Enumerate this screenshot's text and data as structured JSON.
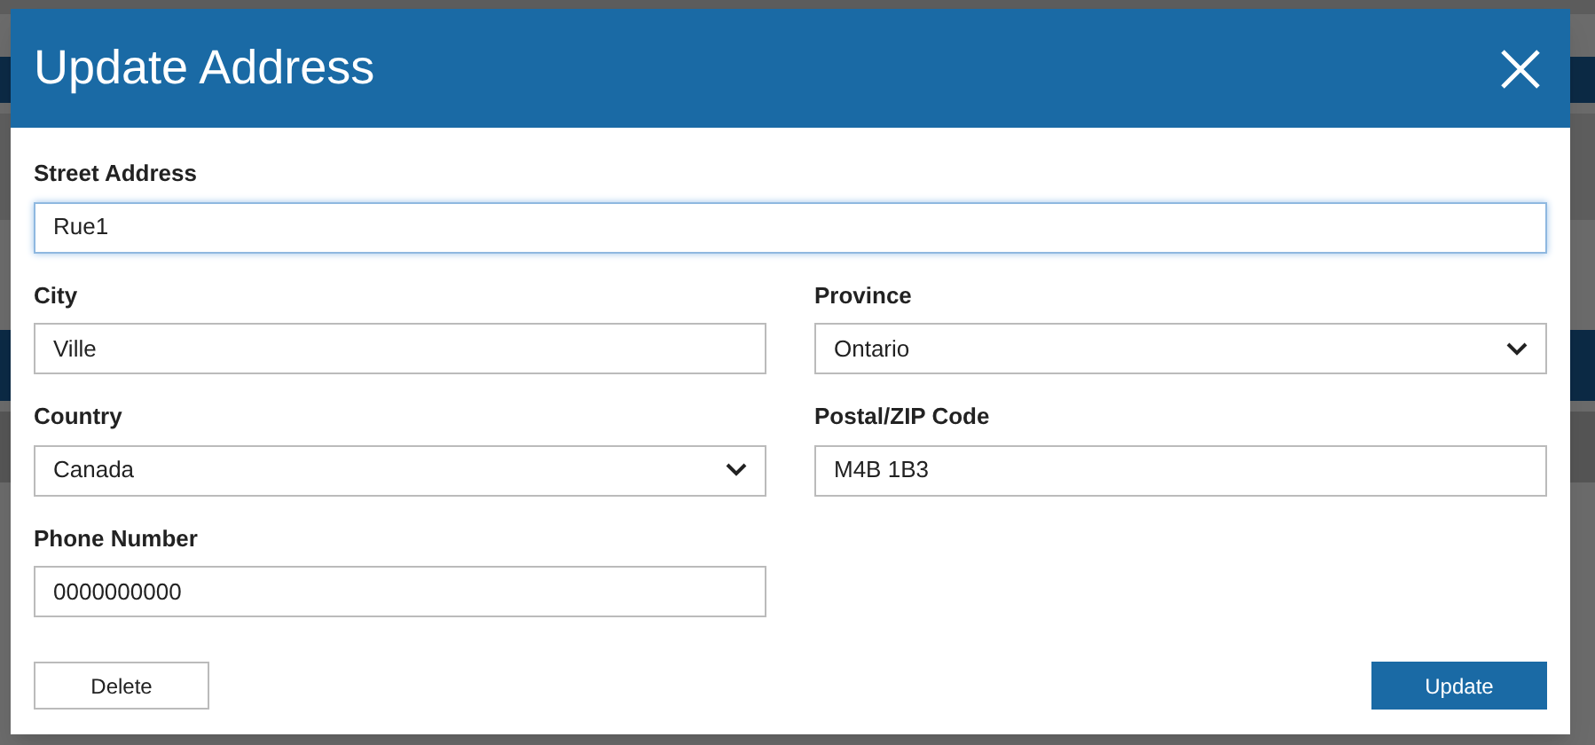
{
  "dialog": {
    "title": "Update Address",
    "fields": [
      {
        "label": "Street Address",
        "kind": "text",
        "value": "Rue1",
        "focused": true,
        "wide": true
      },
      {
        "label": "City",
        "kind": "text",
        "value": "Ville",
        "focused": false,
        "wide": false
      },
      {
        "label": "Province",
        "kind": "select",
        "value": "Ontario",
        "focused": false,
        "wide": false
      },
      {
        "label": "Country",
        "kind": "select",
        "value": "Canada",
        "focused": false,
        "wide": false
      },
      {
        "label": "Postal/ZIP Code",
        "kind": "text",
        "value": "M4B 1B3",
        "focused": false,
        "wide": false
      },
      {
        "label": "Phone Number",
        "kind": "text",
        "value": "0000000000",
        "focused": false,
        "wide": false
      }
    ],
    "buttons": [
      {
        "label": "Delete",
        "kind": "secondary"
      },
      {
        "label": "Update",
        "kind": "primary"
      }
    ]
  }
}
